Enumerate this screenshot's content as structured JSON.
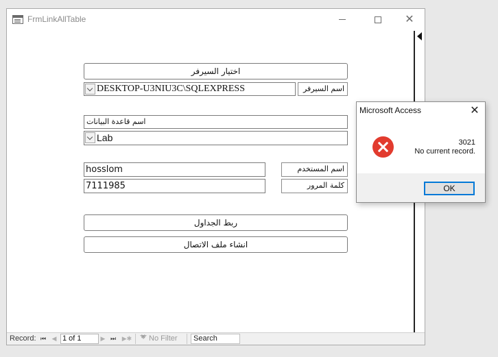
{
  "window": {
    "title": "FrmLinkAllTable",
    "min_icon": "minimize-icon",
    "max_icon": "maximize-icon",
    "close_glyph": "✕"
  },
  "form": {
    "select_server_button": "اختيار السيرفر",
    "server_label": "اسم السيرفر",
    "server_value": "DESKTOP-U3NIU3C\\SQLEXPRESS",
    "database_label": "اسم قاعدة البيانات",
    "database_value": "Lab",
    "username_label": "اسم المستخدم",
    "username_value": "hosslom",
    "password_label": "كلمة المرور",
    "password_value": "7111985",
    "link_tables_button": "ربط الجداول",
    "create_connection_file_button": "انشاء ملف الاتصال"
  },
  "navigation": {
    "record_label": "Record:",
    "first_glyph": "⏮",
    "prev_glyph": "◀",
    "position": "1 of 1",
    "next_glyph": "▶",
    "last_glyph": "⏭",
    "new_glyph": "▶✱",
    "filter_status": "No Filter",
    "search_label": "Search"
  },
  "dialog": {
    "title": "Microsoft Access",
    "close_glyph": "✕",
    "error_code": "3021",
    "message": "No current record.",
    "ok_label": "OK",
    "icon": "error-icon"
  },
  "colors": {
    "error_red": "#e23b2e",
    "focus_blue": "#0078d7"
  }
}
